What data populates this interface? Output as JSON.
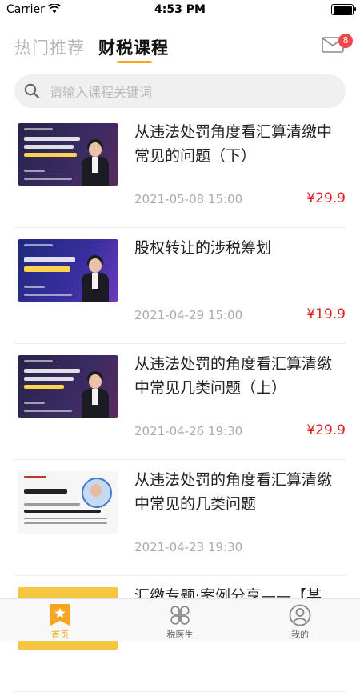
{
  "status_bar": {
    "carrier": "Carrier",
    "time": "4:53 PM",
    "battery_level": 1.0
  },
  "header": {
    "tabs": [
      {
        "label": "热门推荐",
        "active": false
      },
      {
        "label": "财税课程",
        "active": true
      }
    ],
    "mail_badge": "8",
    "accent_color": "#f5a623"
  },
  "search": {
    "placeholder": "请输入课程关键词",
    "value": ""
  },
  "courses": [
    {
      "title": "从违法处罚角度看汇算清缴中常见的问题（下）",
      "date": "2021-05-08 15:00",
      "price": "¥29.9",
      "thumb_style": "dark"
    },
    {
      "title": "股权转让的涉税筹划",
      "date": "2021-04-29 15:00",
      "price": "¥19.9",
      "thumb_style": "blue"
    },
    {
      "title": "从违法处罚的角度看汇算清缴中常见几类问题（上）",
      "date": "2021-04-26 19:30",
      "price": "¥29.9",
      "thumb_style": "dark"
    },
    {
      "title": "从违法处罚的角度看汇算清缴中常见的几类问题",
      "date": "2021-04-23 19:30",
      "price": "",
      "thumb_style": "light"
    },
    {
      "title": "汇缴专题·案例分享——【某",
      "date": "",
      "price": "",
      "thumb_style": "yellow"
    }
  ],
  "tabbar": [
    {
      "label": "首页",
      "icon": "home-star-icon",
      "active": true
    },
    {
      "label": "税医生",
      "icon": "grid-flower-icon",
      "active": false
    },
    {
      "label": "我的",
      "icon": "user-icon",
      "active": false
    }
  ],
  "colors": {
    "price": "#e02020",
    "badge": "#f0474a",
    "active_tab": "#f5a623"
  }
}
